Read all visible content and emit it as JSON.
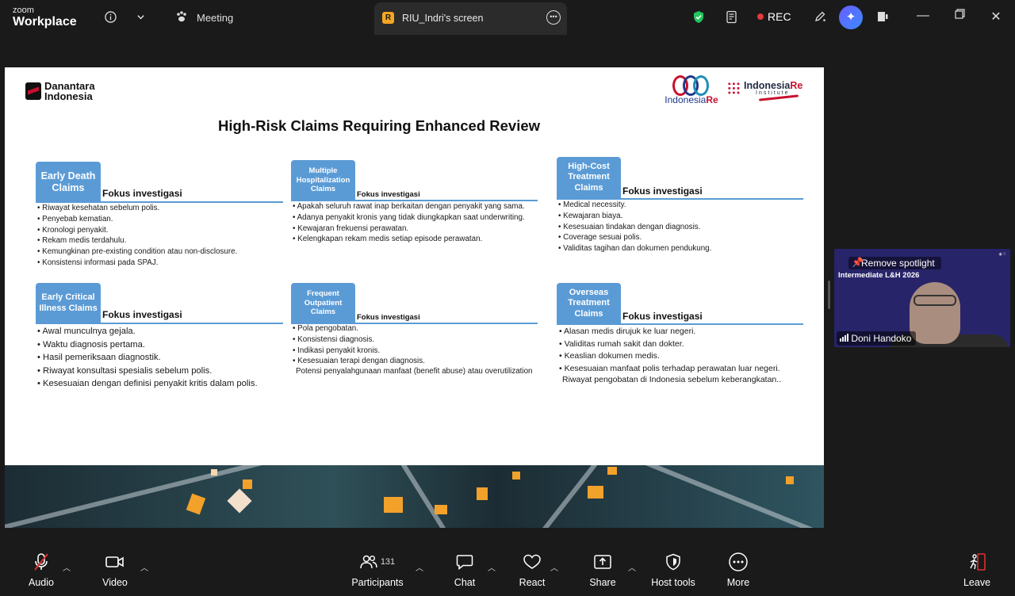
{
  "app": {
    "brand_top": "zoom",
    "brand_bottom": "Workplace"
  },
  "topbar": {
    "meeting_label": "Meeting",
    "share_tab_initial": "R",
    "share_tab_title": "RIU_Indri's screen",
    "rec_label": "REC"
  },
  "slide": {
    "logo_left": [
      "Danantara",
      "Indonesia"
    ],
    "logo_right1": {
      "a": "Indonesia",
      "b": "Re"
    },
    "logo_right2": {
      "a": "Indonesia",
      "b": "Re",
      "sub": "Institute"
    },
    "title": "High-Risk Claims Requiring Enhanced Review",
    "blocks": [
      {
        "tag": "Early Death Claims",
        "fokus": "Fokus investigasi",
        "items": [
          "Riwayat kesehatan sebelum polis.",
          "Penyebab kematian.",
          "Kronologi penyakit.",
          "Rekam medis terdahulu.",
          "Kemungkinan pre-existing condition atau non-disclosure.",
          "Konsistensi informasi pada SPAJ."
        ]
      },
      {
        "tag": "Multiple Hospitalization Claims",
        "fokus": "Fokus investigasi",
        "items": [
          "Apakah seluruh rawat inap berkaitan dengan penyakit yang sama.",
          "Adanya penyakit kronis yang tidak diungkapkan saat underwriting.",
          "Kewajaran frekuensi perawatan.",
          "Kelengkapan rekam medis setiap episode perawatan."
        ]
      },
      {
        "tag": "High-Cost Treatment Claims",
        "fokus": "Fokus investigasi",
        "items": [
          "Medical necessity.",
          "Kewajaran biaya.",
          "Kesesuaian tindakan dengan diagnosis.",
          "Coverage sesuai polis.",
          "Validitas tagihan dan dokumen pendukung."
        ]
      },
      {
        "tag": "Early Critical Illness Claims",
        "fokus": "Fokus investigasi",
        "items": [
          "Awal munculnya gejala.",
          "Waktu diagnosis pertama.",
          "Hasil pemeriksaan diagnostik.",
          "Riwayat konsultasi spesialis sebelum polis.",
          "Kesesuaian dengan definisi penyakit kritis dalam polis."
        ]
      },
      {
        "tag": "Frequent Outpatient Claims",
        "fokus": "Fokus investigasi",
        "items": [
          "Pola pengobatan.",
          "Konsistensi diagnosis.",
          "Indikasi penyakit kronis.",
          "Kesesuaian terapi dengan diagnosis."
        ],
        "extra": "Potensi penyalahgunaan manfaat (benefit abuse) atau overutilization"
      },
      {
        "tag": "Overseas Treatment Claims",
        "fokus": "Fokus investigasi",
        "items": [
          "Alasan medis dirujuk ke luar negeri.",
          "Validitas rumah sakit dan dokter.",
          "Keaslian dokumen medis.",
          "Kesesuaian manfaat polis terhadap perawatan luar negeri."
        ],
        "extra": "Riwayat pengobatan di Indonesia sebelum keberangkatan.."
      }
    ]
  },
  "video": {
    "remove_spotlight": "Remove spotlight",
    "banner": "Intermediate L&H 2026",
    "participant_name": "Doni Handoko"
  },
  "toolbar": {
    "audio": "Audio",
    "video": "Video",
    "participants": "Participants",
    "participants_count": "131",
    "chat": "Chat",
    "react": "React",
    "share": "Share",
    "host_tools": "Host tools",
    "more": "More",
    "leave": "Leave"
  },
  "colors": {
    "accent_blue": "#5b9bd5",
    "rec_red": "#e23b3b",
    "leave_red": "#e02f2f"
  }
}
